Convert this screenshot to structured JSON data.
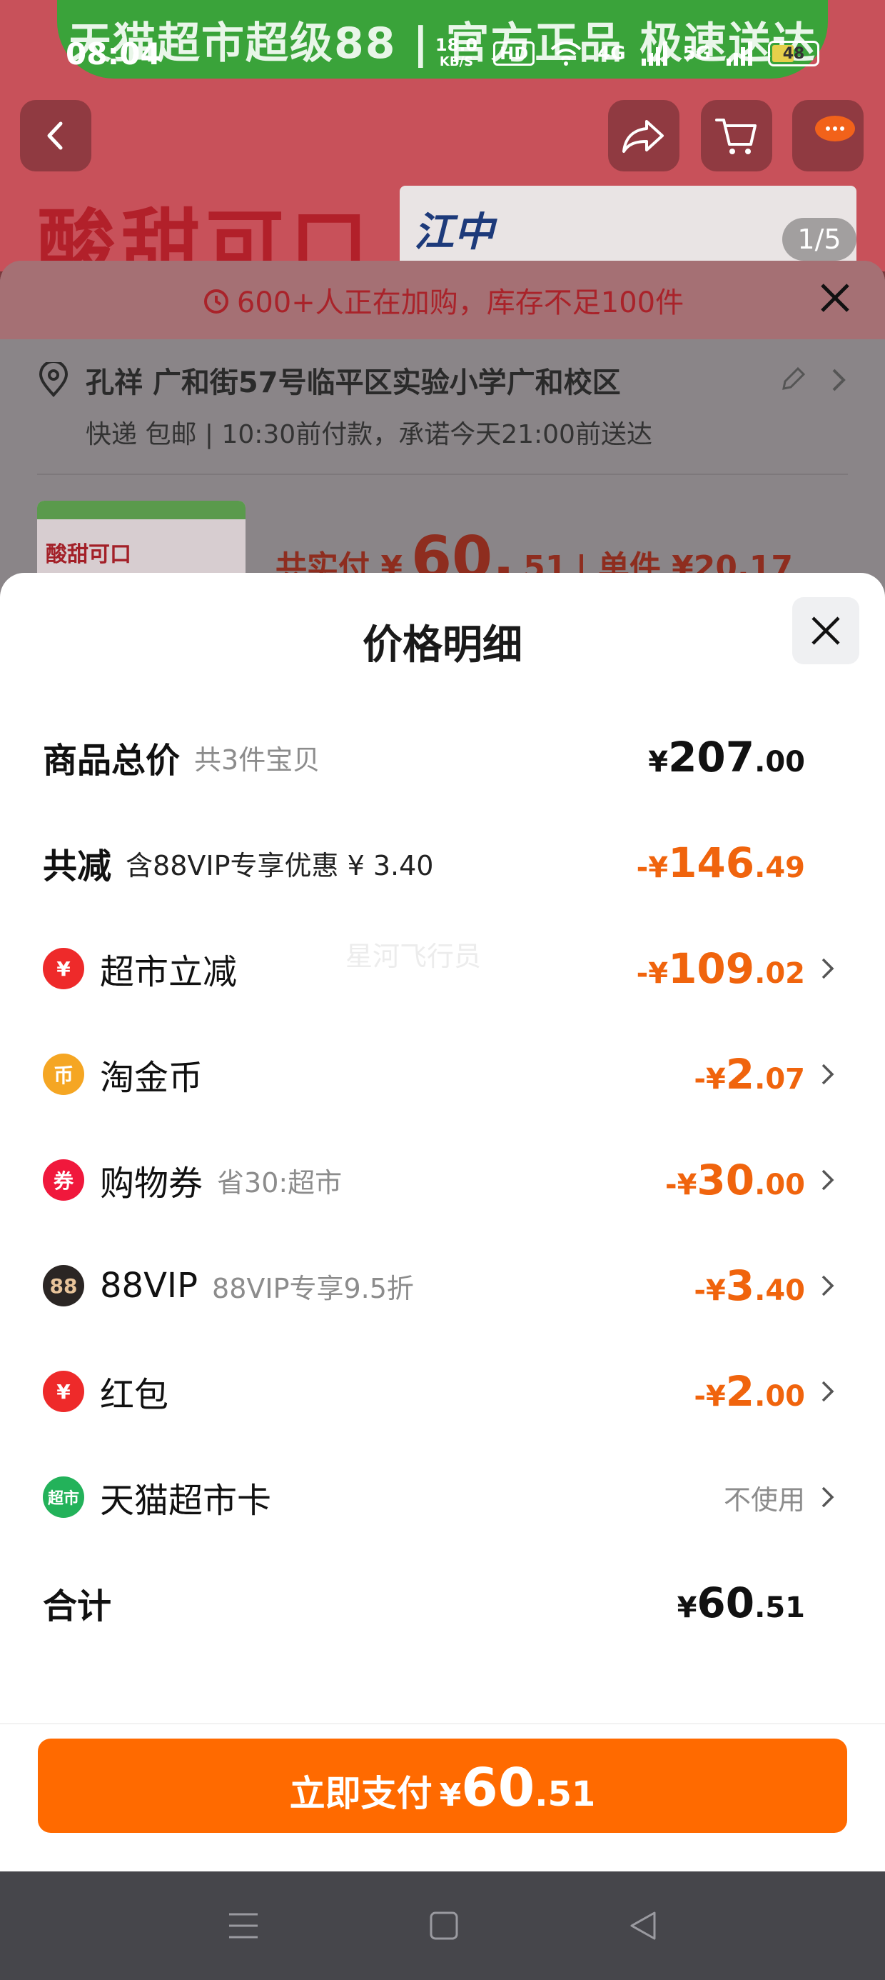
{
  "status_bar": {
    "time": "08:04",
    "net_speed": "18.0",
    "net_unit": "KB/S",
    "hd": "HD",
    "sig1": "4G",
    "sig2": "5G",
    "battery": "48"
  },
  "background": {
    "banner": "天猫超市超级88 | 官方正品 极速送达",
    "tagline": "酸甜可口",
    "brand": "江中",
    "pager": "1/5",
    "alert": "600+人正在加购，库存不足100件",
    "address_line1": "孔祥 广和街57号临平区实验小学广和校区",
    "address_line2": "快递 包邮 | 10:30前付款，承诺今天21:00前送达",
    "thumb_text": "酸甜可口",
    "total_label": "共实付 ¥",
    "total_int": "60.",
    "total_dec": "51",
    "unit_price": "| 单件 ¥20.17"
  },
  "modal": {
    "title": "价格明细",
    "watermark": "星河飞行员",
    "rows": [
      {
        "name": "商品总价",
        "sub": "共3件宝贝",
        "cur": "¥",
        "int": "207",
        "dec": ".00"
      },
      {
        "name": "共减",
        "sub": "含88VIP专享优惠 ¥ 3.40",
        "cur": "-¥",
        "int": "146",
        "dec": ".49"
      },
      {
        "name": "超市立减",
        "sub": "",
        "icon_text": "¥",
        "cur": "-¥",
        "int": "109",
        "dec": ".02"
      },
      {
        "name": "淘金币",
        "sub": "",
        "icon_text": "币",
        "cur": "-¥",
        "int": "2",
        "dec": ".07"
      },
      {
        "name": "购物券",
        "sub": "省30:超市",
        "icon_text": "券",
        "cur": "-¥",
        "int": "30",
        "dec": ".00"
      },
      {
        "name": "88VIP",
        "sub": "88VIP专享9.5折",
        "icon_text": "88",
        "cur": "-¥",
        "int": "3",
        "dec": ".40"
      },
      {
        "name": "红包",
        "sub": "",
        "icon_text": "¥",
        "cur": "-¥",
        "int": "2",
        "dec": ".00"
      },
      {
        "name": "天猫超市卡",
        "sub": "",
        "icon_text": "超市",
        "value": "不使用"
      },
      {
        "name": "合计",
        "sub": "",
        "cur": "¥",
        "int": "60",
        "dec": ".51"
      }
    ],
    "pay_button": {
      "label": "立即支付",
      "cur": "¥",
      "int": "60",
      "dec": ".51"
    }
  },
  "colors": {
    "accent_orange": "#ff6a00",
    "discount_orange": "#f0640d",
    "supermarket_red": "#ee2a2a",
    "coin_gold": "#f5a623",
    "vip_dark": "#2b2624",
    "card_green": "#23b25a"
  },
  "icons": [
    "back-icon",
    "share-icon",
    "cart-icon",
    "more-icon",
    "alarm-icon",
    "close-icon",
    "location-icon",
    "edit-icon",
    "chevron-right-icon",
    "menu-icon",
    "home-icon",
    "back-triangle-icon"
  ]
}
